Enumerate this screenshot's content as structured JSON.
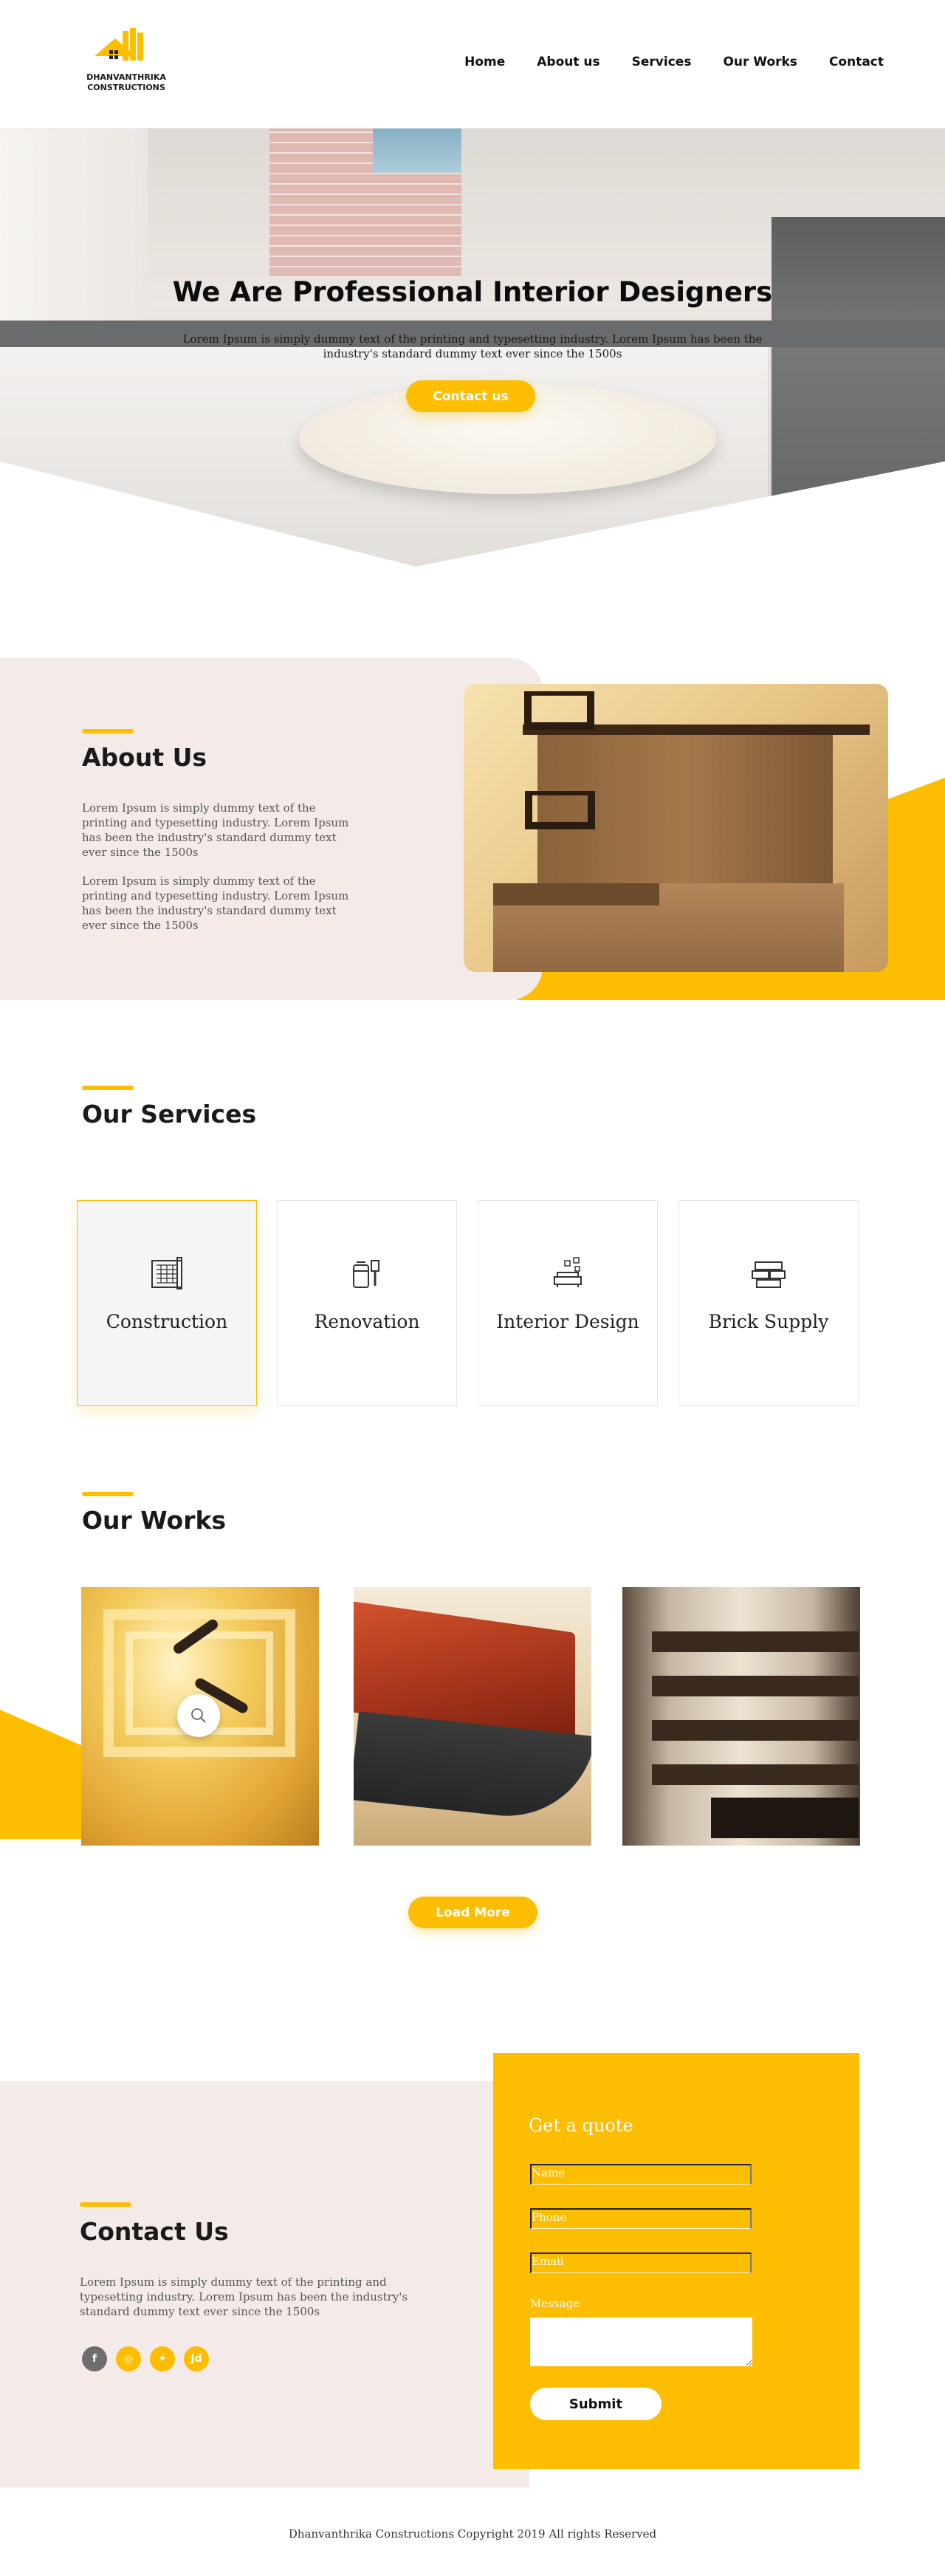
{
  "brand": {
    "name_line1": "DHANVANTHRIKA",
    "name_line2": "CONSTRUCTIONS",
    "accent": "#fdbd00"
  },
  "nav": {
    "items": [
      {
        "label": "Home"
      },
      {
        "label": "About us"
      },
      {
        "label": "Services"
      },
      {
        "label": "Our Works"
      },
      {
        "label": "Contact"
      }
    ]
  },
  "hero": {
    "title": "We Are Professional Interior Designers",
    "text": "Lorem Ipsum is simply dummy text of the printing and typesetting industry. Lorem Ipsum has been the industry's standard dummy text ever since the 1500s",
    "cta": "Contact us"
  },
  "about": {
    "title": "About Us",
    "p1": "Lorem Ipsum is simply dummy text of the printing and typesetting industry. Lorem Ipsum has been the industry's standard dummy text ever since the 1500s",
    "p2": "Lorem Ipsum is simply dummy text of the printing and typesetting industry. Lorem Ipsum has been the industry's standard dummy text ever since the 1500s"
  },
  "services": {
    "title": "Our Services",
    "items": [
      {
        "label": "Construction",
        "icon": "blueprint-icon"
      },
      {
        "label": "Renovation",
        "icon": "paint-brush-icon"
      },
      {
        "label": "Interior Design",
        "icon": "sofa-icon"
      },
      {
        "label": "Brick Supply",
        "icon": "bricks-icon"
      }
    ]
  },
  "works": {
    "title": "Our Works",
    "load_more": "Load More"
  },
  "contact": {
    "title": "Contact Us",
    "text": "Lorem Ipsum is simply dummy text of the printing and typesetting industry. Lorem Ipsum has been the industry's standard dummy text ever since the 1500s",
    "socials": [
      {
        "glyph": "f",
        "icon": "facebook-icon"
      },
      {
        "glyph": "◎",
        "icon": "instagram-icon"
      },
      {
        "glyph": "✦",
        "icon": "twitter-icon"
      },
      {
        "glyph": "Jd",
        "icon": "justdial-icon"
      }
    ]
  },
  "quote": {
    "title": "Get a quote",
    "name_placeholder": "Name",
    "phone_placeholder": "Phone",
    "email_placeholder": "Email",
    "message_label": "Message",
    "submit": "Submit"
  },
  "footer": {
    "copyright": "Dhanvanthrika Constructions Copyright 2019 All rights Reserved"
  }
}
